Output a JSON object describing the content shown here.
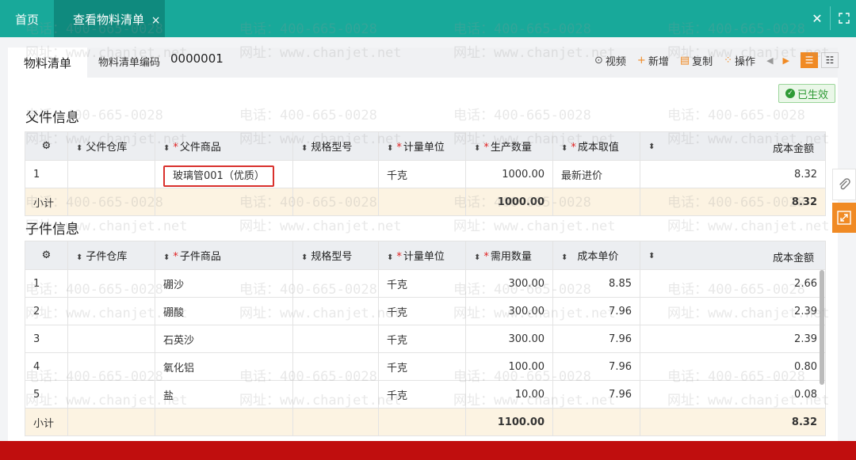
{
  "topbar": {
    "home": "首页",
    "tab": "查看物料清单",
    "tab_close": "×",
    "close": "✕"
  },
  "subheader": {
    "tab": "物料清单",
    "code_label": "物料清单编码",
    "code_value": "0000001"
  },
  "toolbar": {
    "video": "视频",
    "add": "新增",
    "copy": "复制",
    "ops": "操作"
  },
  "status_badge": "已生效",
  "parent": {
    "title": "父件信息",
    "headers": [
      "父件仓库",
      "父件商品",
      "规格型号",
      "计量单位",
      "生产数量",
      "成本取值",
      "成本金额"
    ],
    "rows": [
      {
        "idx": "1",
        "warehouse": "",
        "product": "玻璃管001（优质）",
        "spec": "",
        "unit": "千克",
        "qty": "1000.00",
        "cost_src": "最新进价",
        "amount": "8.32"
      }
    ],
    "subtotal": {
      "label": "小计",
      "qty": "1000.00",
      "amount": "8.32"
    }
  },
  "child": {
    "title": "子件信息",
    "headers": [
      "子件仓库",
      "子件商品",
      "规格型号",
      "计量单位",
      "需用数量",
      "成本单价",
      "成本金额"
    ],
    "rows": [
      {
        "idx": "1",
        "warehouse": "",
        "product": "硼沙",
        "spec": "",
        "unit": "千克",
        "qty": "300.00",
        "price": "8.85",
        "amount": "2.66"
      },
      {
        "idx": "2",
        "warehouse": "",
        "product": "硼酸",
        "spec": "",
        "unit": "千克",
        "qty": "300.00",
        "price": "7.96",
        "amount": "2.39"
      },
      {
        "idx": "3",
        "warehouse": "",
        "product": "石英沙",
        "spec": "",
        "unit": "千克",
        "qty": "300.00",
        "price": "7.96",
        "amount": "2.39"
      },
      {
        "idx": "4",
        "warehouse": "",
        "product": "氧化铝",
        "spec": "",
        "unit": "千克",
        "qty": "100.00",
        "price": "7.96",
        "amount": "0.80"
      },
      {
        "idx": "5",
        "warehouse": "",
        "product": "盐",
        "spec": "",
        "unit": "千克",
        "qty": "10.00",
        "price": "7.96",
        "amount": "0.08"
      }
    ],
    "subtotal": {
      "label": "小计",
      "qty": "1100.00",
      "amount": "8.32"
    }
  },
  "watermark": {
    "phone": "电话：400-665-0028",
    "site": "网址：www.chanjet.net"
  },
  "colors": {
    "teal": "#18a99a",
    "teal_dark": "#0f8a7e",
    "orange": "#f08a24",
    "required": "#e02020",
    "subtotal_bg": "#fcf3e2",
    "footer_red": "#c00e0e"
  }
}
